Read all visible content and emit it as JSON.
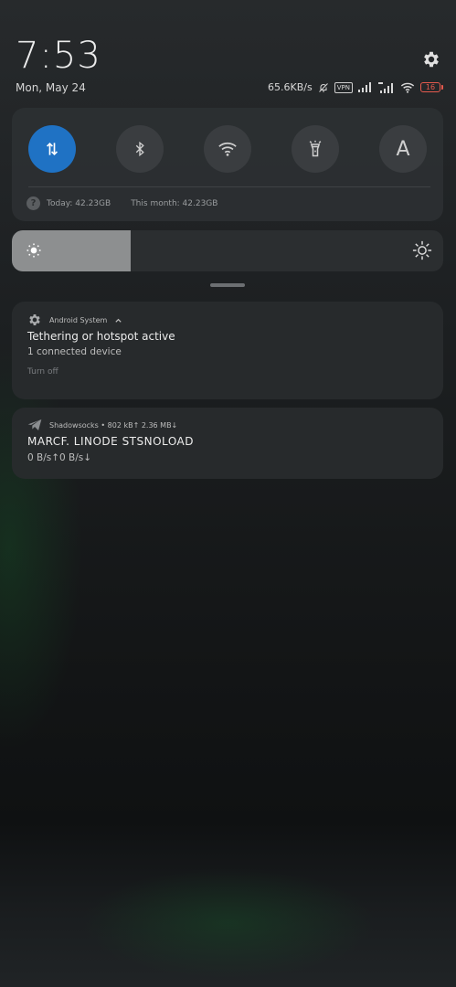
{
  "header": {
    "time": "7:53",
    "date": "Mon, May 24"
  },
  "status_bar": {
    "speed": "65.6KB/s",
    "vpn": "VPN",
    "battery": "16",
    "icons": [
      "bell-off-icon",
      "signal-icon",
      "signal-icon",
      "wifi-icon"
    ]
  },
  "quick_settings": {
    "tiles": [
      {
        "name": "mobile-data",
        "icon": "arrows-updown-icon",
        "active": true
      },
      {
        "name": "bluetooth",
        "icon": "bluetooth-icon",
        "active": false
      },
      {
        "name": "wifi",
        "icon": "wifi-icon",
        "active": false
      },
      {
        "name": "flashlight",
        "icon": "flashlight-icon",
        "active": false
      },
      {
        "name": "auto-brightness",
        "icon": "letter-a-icon",
        "label": "A",
        "active": false
      }
    ],
    "data_today": "Today: 42.23GB",
    "data_month": "This month: 42.23GB",
    "accent_color": "#1f72c4"
  },
  "brightness": {
    "level": 0.275
  },
  "notifications": [
    {
      "app": "Android System",
      "title": "Tethering or hotspot active",
      "text": "1 connected device",
      "action": "Turn off"
    },
    {
      "app": "Shadowsocks • 802 kB↑ 2.36 MB↓",
      "title": "MARCF. LINODE STSNOLOAD",
      "text": "0 B/s↑0 B/s↓"
    }
  ]
}
